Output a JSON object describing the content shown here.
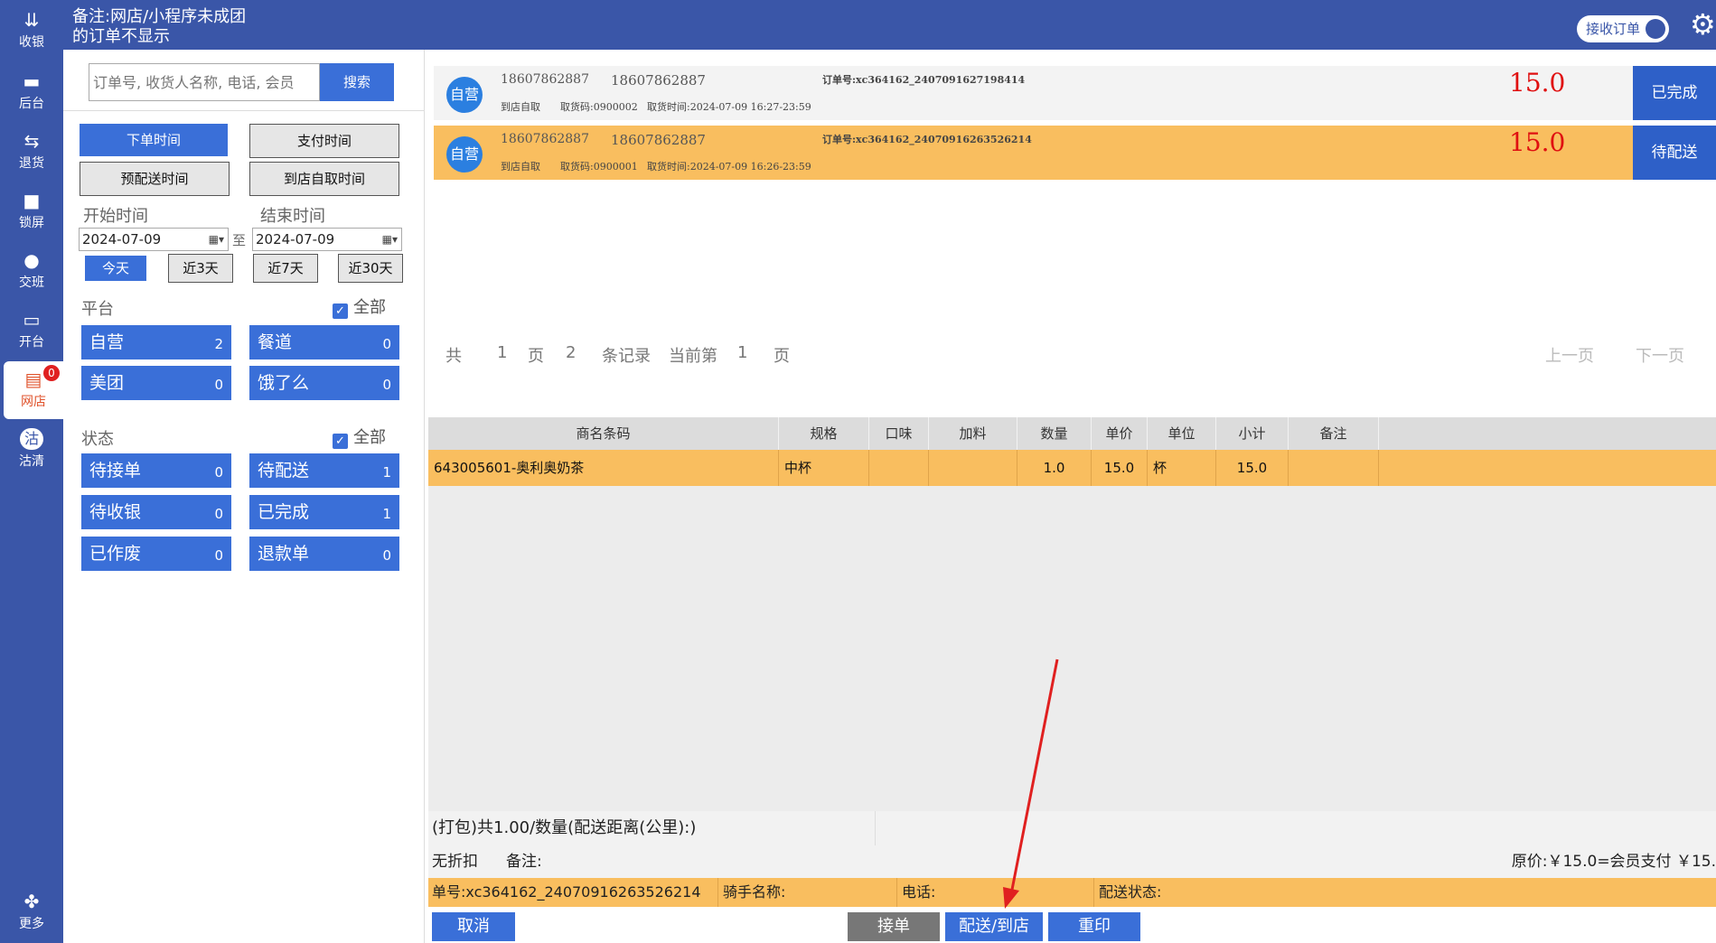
{
  "sidebar": {
    "items": [
      {
        "label": "收银",
        "icon": "cashier-icon"
      },
      {
        "label": "后台",
        "icon": "monitor-icon"
      },
      {
        "label": "退货",
        "icon": "return-icon"
      },
      {
        "label": "锁屏",
        "icon": "lock-icon"
      },
      {
        "label": "交班",
        "icon": "handover-icon"
      },
      {
        "label": "开台",
        "icon": "table-icon"
      },
      {
        "label": "网店",
        "icon": "store-icon",
        "badge": "0"
      },
      {
        "label": "沽清",
        "icon": "soldout-icon"
      },
      {
        "label": "更多",
        "icon": "more-icon"
      }
    ]
  },
  "header": {
    "note_line1": "备注:网店/小程序未成团",
    "note_line2": "的订单不显示",
    "toggle_label": "接收订单"
  },
  "search": {
    "placeholder": "订单号, 收货人名称, 电话, 会员",
    "button": "搜索"
  },
  "time_filters": {
    "order_time": "下单时间",
    "pay_time": "支付时间",
    "pre_delivery_time": "预配送时间",
    "pickup_time": "到店自取时间",
    "start_label": "开始时间",
    "end_label": "结束时间",
    "start_date": "2024-07-09",
    "end_date": "2024-07-09",
    "to": "至",
    "today": "今天",
    "last3": "近3天",
    "last7": "近7天",
    "last30": "近30天"
  },
  "platform": {
    "title": "平台",
    "all": "全部",
    "items": [
      {
        "label": "自营",
        "count": "2"
      },
      {
        "label": "餐道",
        "count": "0"
      },
      {
        "label": "美团",
        "count": "0"
      },
      {
        "label": "饿了么",
        "count": "0"
      }
    ]
  },
  "status": {
    "title": "状态",
    "all": "全部",
    "items": [
      {
        "label": "待接单",
        "count": "0"
      },
      {
        "label": "待配送",
        "count": "1"
      },
      {
        "label": "待收银",
        "count": "0"
      },
      {
        "label": "已完成",
        "count": "1"
      },
      {
        "label": "已作废",
        "count": "0"
      },
      {
        "label": "退款单",
        "count": "0"
      }
    ]
  },
  "orders": [
    {
      "avatar": "自营",
      "phone1": "18607862887",
      "phone2": "18607862887",
      "order_no": "订单号:xc364162_2407091627198414",
      "mode": "到店自取",
      "pickup_code": "取货码:0900002",
      "pickup_time": "取货时间:2024-07-09 16:27-23:59",
      "price": "15.0",
      "status": "已完成"
    },
    {
      "avatar": "自营",
      "phone1": "18607862887",
      "phone2": "18607862887",
      "order_no": "订单号:xc364162_24070916263526214",
      "mode": "到店自取",
      "pickup_code": "取货码:0900001",
      "pickup_time": "取货时间:2024-07-09 16:26-23:59",
      "price": "15.0",
      "status": "待配送"
    }
  ],
  "pagination": {
    "total_prefix": "共",
    "total_pages": "1",
    "page_word": "页",
    "records": "2",
    "records_word": "条记录",
    "current_prefix": "当前第",
    "current": "1",
    "current_suffix": "页",
    "prev": "上一页",
    "next": "下一页"
  },
  "table": {
    "headers": [
      "商名条码",
      "规格",
      "口味",
      "加料",
      "数量",
      "单价",
      "单位",
      "小计",
      "备注"
    ],
    "rows": [
      [
        "643005601-奥利奥奶茶",
        "中杯",
        "",
        "",
        "1.0",
        "15.0",
        "杯",
        "15.0",
        ""
      ]
    ]
  },
  "summary": {
    "packing": "(打包)共1.00/数量(配送距离(公里):)",
    "discount": "无折扣",
    "remark": "备注:",
    "price_line": "原价:￥15.0=会员支付 ￥15.",
    "order_no": "单号:xc364162_24070916263526214",
    "rider": "骑手名称:",
    "phone": "电话:",
    "delivery_status": "配送状态:"
  },
  "actions": {
    "cancel": "取消",
    "accept": "接单",
    "deliver": "配送/到店",
    "reprint": "重印"
  },
  "colors": {
    "primary": "#3a56a8",
    "accent": "#3a6fd8",
    "highlight": "#f9be5f",
    "price": "#e01010"
  }
}
